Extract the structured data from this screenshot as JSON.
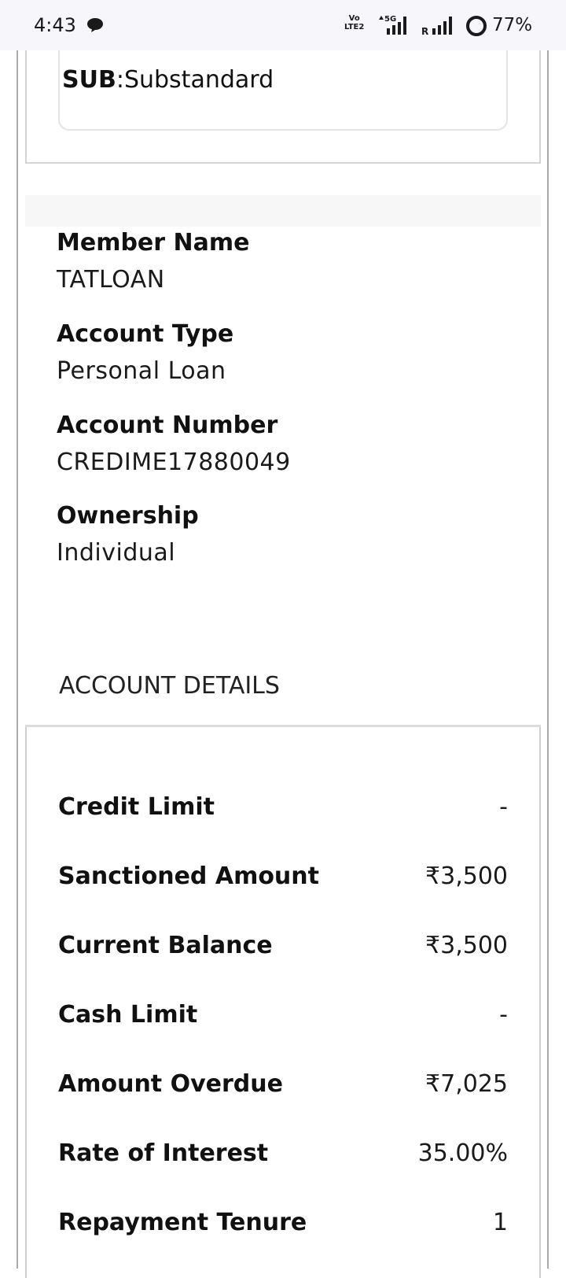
{
  "status_bar": {
    "time": "4:43",
    "network_volte_line1": "Vo",
    "network_volte_line2": "LTE2",
    "network_type": "5G",
    "roaming": "R",
    "battery": "77%"
  },
  "legend": {
    "code": "SUB",
    "separator": ":",
    "meaning": "Substandard"
  },
  "member": {
    "name_label": "Member Name",
    "name_value": "TATLOAN",
    "account_type_label": "Account Type",
    "account_type_value": "Personal Loan",
    "account_number_label": "Account Number",
    "account_number_value": "CREDIME17880049",
    "ownership_label": "Ownership",
    "ownership_value": "Individual"
  },
  "account_details": {
    "heading": "ACCOUNT DETAILS",
    "rows": [
      {
        "label": "Credit Limit",
        "value": "-"
      },
      {
        "label": "Sanctioned Amount",
        "value": "₹3,500"
      },
      {
        "label": "Current Balance",
        "value": "₹3,500"
      },
      {
        "label": "Cash Limit",
        "value": "-"
      },
      {
        "label": "Amount Overdue",
        "value": "₹7,025"
      },
      {
        "label": "Rate of Interest",
        "value": "35.00%"
      },
      {
        "label": "Repayment Tenure",
        "value": "1"
      }
    ]
  }
}
